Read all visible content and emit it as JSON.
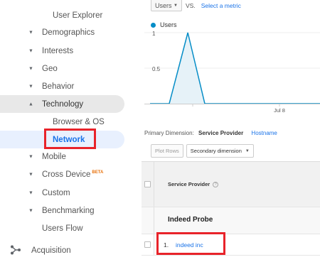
{
  "sidebar": {
    "items": [
      {
        "label": "User Explorer"
      },
      {
        "label": "Demographics"
      },
      {
        "label": "Interests"
      },
      {
        "label": "Geo"
      },
      {
        "label": "Behavior"
      },
      {
        "label": "Technology"
      },
      {
        "label": "Browser & OS"
      },
      {
        "label": "Network"
      },
      {
        "label": "Mobile"
      },
      {
        "label": "Cross Device",
        "badge": "BETA"
      },
      {
        "label": "Custom"
      },
      {
        "label": "Benchmarking"
      },
      {
        "label": "Users Flow"
      },
      {
        "label": "Acquisition"
      }
    ],
    "caret_collapsed": "▼",
    "caret_expanded": "▲"
  },
  "metric": {
    "selected": "Users",
    "vs": "VS.",
    "select_metric": "Select a metric",
    "dropdown_glyph": "▼"
  },
  "chart_data": {
    "type": "area",
    "legend": [
      {
        "name": "Users",
        "color": "#058dc7"
      }
    ],
    "y_ticks": [
      "1",
      "0.5"
    ],
    "ylim": [
      0,
      1
    ],
    "x_tick_labels": [
      "Jul 8"
    ],
    "series": [
      {
        "name": "Users",
        "values": [
          0,
          0,
          1,
          0,
          0,
          0,
          0,
          0,
          0,
          0
        ]
      }
    ],
    "line_color": "#058dc7",
    "fill_color": "#e6f2f8"
  },
  "dimension": {
    "label": "Primary Dimension:",
    "current": "Service Provider",
    "alt": "Hostname"
  },
  "controls": {
    "plot_rows": "Plot Rows",
    "secondary": "Secondary dimension",
    "dropdown_glyph": "▼"
  },
  "table": {
    "column_header": "Service Provider",
    "help_glyph": "?",
    "group": "Indeed Probe",
    "rows": [
      {
        "index": "1.",
        "value": "indeed inc"
      }
    ]
  },
  "colors": {
    "highlight": "#e8232a",
    "link": "#1a73e8"
  }
}
